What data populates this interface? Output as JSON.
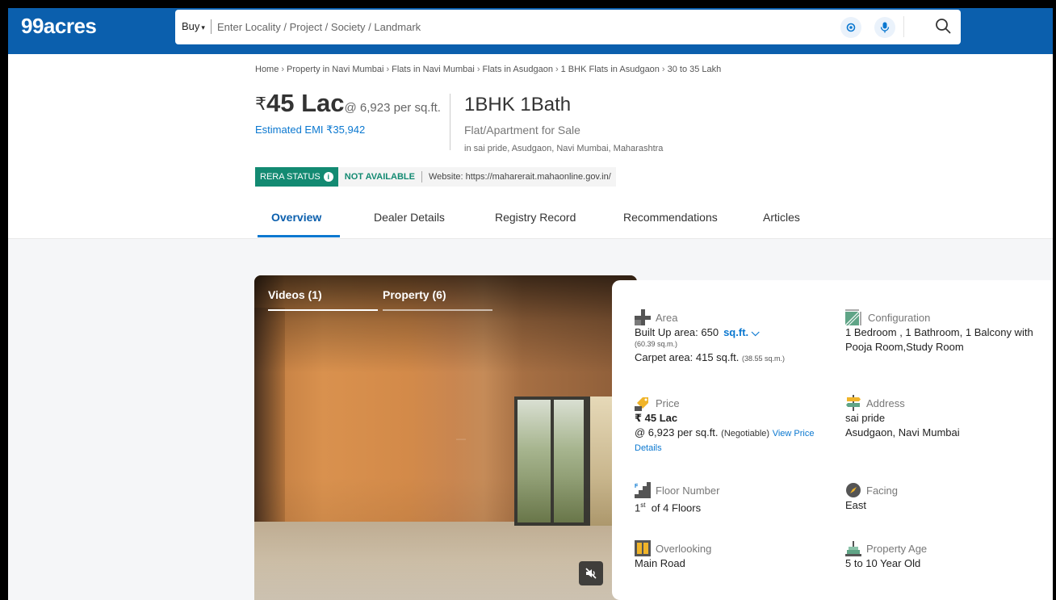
{
  "header": {
    "logo": "99acres",
    "buy_label": "Buy",
    "search_placeholder": "Enter Locality / Project / Society / Landmark"
  },
  "breadcrumb": [
    "Home",
    "Property in Navi Mumbai",
    "Flats in Navi Mumbai",
    "Flats in Asudgaon",
    "1 BHK Flats in Asudgaon",
    "30 to 35 Lakh"
  ],
  "price": {
    "currency": "₹",
    "amount": "45 Lac",
    "rate": "@ 6,923 per sq.ft.",
    "emi": "Estimated EMI ₹35,942"
  },
  "listing": {
    "title": "1BHK 1Bath",
    "subtitle": "Flat/Apartment for Sale",
    "location": "in sai pride, Asudgaon, Navi Mumbai, Maharashtra"
  },
  "rera": {
    "label": "RERA STATUS",
    "status": "NOT AVAILABLE",
    "website": "Website: https://maharerait.mahaonline.gov.in/"
  },
  "tabs": [
    "Overview",
    "Dealer Details",
    "Registry Record",
    "Recommendations",
    "Articles"
  ],
  "media": {
    "tabs": [
      "Videos (1)",
      "Property (6)"
    ]
  },
  "details": {
    "area": {
      "label": "Area",
      "built_up": "Built Up area: 650",
      "unit": "sq.ft.",
      "built_up_sqm": "(60.39 sq.m.)",
      "carpet": "Carpet area: 415 sq.ft.",
      "carpet_sqm": "(38.55 sq.m.)"
    },
    "configuration": {
      "label": "Configuration",
      "line1": "1 Bedroom , 1 Bathroom, 1 Balcony with",
      "line2": "Pooja Room,Study Room"
    },
    "price": {
      "label": "Price",
      "value": "₹ 45 Lac",
      "rate": "@ 6,923 per sq.ft.",
      "negotiable": "(Negotiable)",
      "link1": "View Price",
      "link2": "Details"
    },
    "address": {
      "label": "Address",
      "line1": "sai pride",
      "line2": "Asudgaon, Navi Mumbai"
    },
    "floor": {
      "label": "Floor Number",
      "num": "1",
      "sup": "st",
      "of": "of 4 Floors"
    },
    "facing": {
      "label": "Facing",
      "value": "East"
    },
    "overlooking": {
      "label": "Overlooking",
      "value": "Main Road"
    },
    "age": {
      "label": "Property Age",
      "value": "5 to 10 Year Old"
    }
  }
}
